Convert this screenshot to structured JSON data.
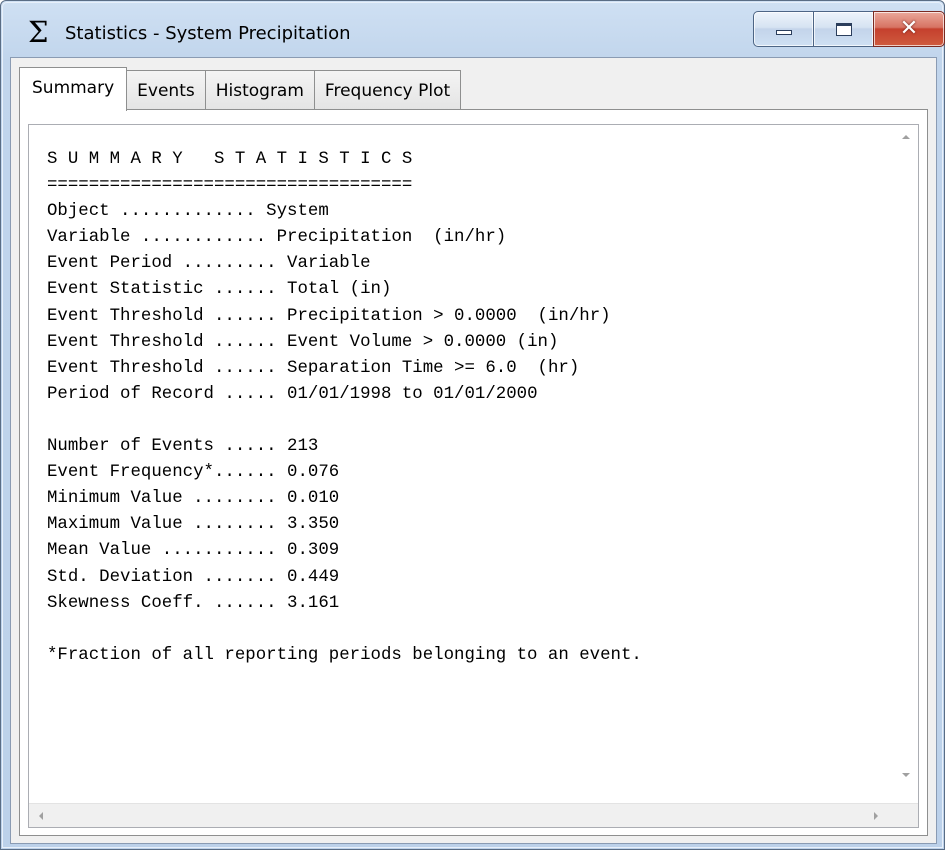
{
  "window": {
    "title": "Statistics - System Precipitation",
    "icon": "sigma-icon",
    "icon_glyph": "Σ",
    "buttons": {
      "minimize": "minimize-icon",
      "maximize": "maximize-icon",
      "close": "close-icon",
      "close_glyph": "✕"
    },
    "colors": {
      "close_button": "#c5402d",
      "frame": "#c1d5ec"
    }
  },
  "tabs": [
    {
      "label": "Summary",
      "active": true
    },
    {
      "label": "Events",
      "active": false
    },
    {
      "label": "Histogram",
      "active": false
    },
    {
      "label": "Frequency Plot",
      "active": false
    }
  ],
  "summary": {
    "heading": "SUMMARY STATISTICS",
    "heading_display": "S U M M A R Y   S T A T I S T I C S",
    "separator": "===================================",
    "params": [
      {
        "label": "Object .............",
        "value": "System"
      },
      {
        "label": "Variable ............",
        "value": "Precipitation  (in/hr)"
      },
      {
        "label": "Event Period .........",
        "value": "Variable"
      },
      {
        "label": "Event Statistic ......",
        "value": "Total (in)"
      },
      {
        "label": "Event Threshold ......",
        "value": "Precipitation > 0.0000  (in/hr)"
      },
      {
        "label": "Event Threshold ......",
        "value": "Event Volume > 0.0000 (in)"
      },
      {
        "label": "Event Threshold ......",
        "value": "Separation Time >= 6.0  (hr)"
      },
      {
        "label": "Period of Record .....",
        "value": "01/01/1998 to 01/01/2000"
      }
    ],
    "stats": [
      {
        "label": "Number of Events .....",
        "value": "213"
      },
      {
        "label": "Event Frequency*......",
        "value": "0.076"
      },
      {
        "label": "Minimum Value ........",
        "value": "0.010"
      },
      {
        "label": "Maximum Value ........",
        "value": "3.350"
      },
      {
        "label": "Mean Value ...........",
        "value": "0.309"
      },
      {
        "label": "Std. Deviation .......",
        "value": "0.449"
      },
      {
        "label": "Skewness Coeff. ......",
        "value": "3.161"
      }
    ],
    "footnote": "*Fraction of all reporting periods belonging to an event."
  }
}
